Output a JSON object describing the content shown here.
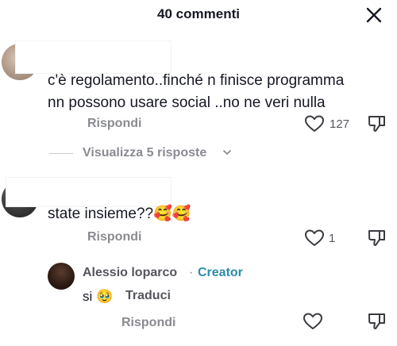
{
  "header": {
    "title": "40 commenti"
  },
  "icons": {
    "close": "close-icon",
    "like": "heart-outline-icon",
    "dislike": "thumb-down-icon",
    "chevron": "chevron-down-icon"
  },
  "colors": {
    "text": "#161823",
    "muted": "#8a8b91",
    "creator": "#2e8ba8"
  },
  "comments": [
    {
      "text_lines": [
        "c'è regolamento..finché n finisce programma",
        "nn possono usare social ..no ne veri nulla"
      ],
      "reply_label": "Rispondi",
      "likes": "127",
      "view_replies": "Visualizza 5 risposte"
    },
    {
      "text": "state insieme??",
      "emojis": "🥰🥰",
      "reply_label": "Rispondi",
      "likes": "1"
    }
  ],
  "reply": {
    "author": "Alessio loparco",
    "separator": "·",
    "badge": "Creator",
    "text": "si",
    "emoji": "🥹",
    "translate": "Traduci",
    "reply_label": "Rispondi"
  }
}
